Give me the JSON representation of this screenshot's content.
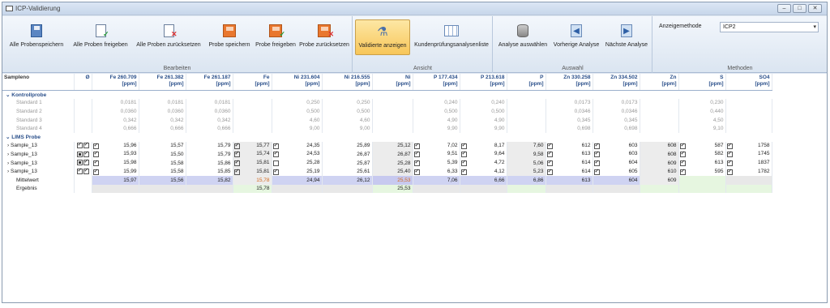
{
  "window": {
    "title": "ICP-Validierung"
  },
  "ribbon": {
    "bearbeiten": {
      "label": "Bearbeiten",
      "buttons": [
        "Alle Probenspeichern",
        "Alle Proben freigeben",
        "Alle Proben zurücksetzen",
        "Probe speichern",
        "Probe freigeben",
        "Probe zurücksetzen"
      ]
    },
    "ansicht": {
      "label": "Ansicht",
      "buttons": [
        "Validierte anzeigen",
        "Kundenprüfungsanalysenliste"
      ]
    },
    "auswahl": {
      "label": "Auswahl",
      "buttons": [
        "Analyse auswählen",
        "Vorherige Analyse",
        "Nächste Analyse"
      ]
    },
    "methoden": {
      "label": "Methoden",
      "anzeige_label": "Anzeigemethode",
      "anzeige_value": "ICP2"
    }
  },
  "table": {
    "headers": [
      [
        "Sampleno",
        ""
      ],
      [
        "Ø",
        ""
      ],
      [
        "Fe 260.709",
        "[ppm]"
      ],
      [
        "Fe 261.382",
        "[ppm]"
      ],
      [
        "Fe 261.187",
        "[ppm]"
      ],
      [
        "Fe",
        "[ppm]"
      ],
      [
        "Ni 231.604",
        "[ppm]"
      ],
      [
        "Ni 216.555",
        "[ppm]"
      ],
      [
        "Ni",
        "[ppm]"
      ],
      [
        "P 177.434",
        "[ppm]"
      ],
      [
        "P 213.618",
        "[ppm]"
      ],
      [
        "P",
        "[ppm]"
      ],
      [
        "Zn 330.258",
        "[ppm]"
      ],
      [
        "Zn 334.502",
        "[ppm]"
      ],
      [
        "Zn",
        "[ppm]"
      ],
      [
        "S",
        "[ppm]"
      ],
      [
        "SO4",
        "[ppm]"
      ]
    ],
    "kontroll_label": "Kontrollprobe",
    "standards": [
      {
        "name": "Standard 1",
        "v": [
          "",
          "0,0181",
          "0,0181",
          "0,0181",
          "",
          "0,250",
          "0,250",
          "",
          "0,240",
          "0,240",
          "",
          "0,0173",
          "0,0173",
          "",
          "0,230",
          ""
        ]
      },
      {
        "name": "Standard 2",
        "v": [
          "",
          "0,0360",
          "0,0360",
          "0,0360",
          "",
          "0,500",
          "0,500",
          "",
          "0,500",
          "0,500",
          "",
          "0,0346",
          "0,0346",
          "",
          "0,440",
          ""
        ]
      },
      {
        "name": "Standard 3",
        "v": [
          "",
          "0,342",
          "0,342",
          "0,342",
          "",
          "4,60",
          "4,60",
          "",
          "4,90",
          "4,90",
          "",
          "0,345",
          "0,345",
          "",
          "4,50",
          ""
        ]
      },
      {
        "name": "Standard 4",
        "v": [
          "",
          "0,666",
          "0,666",
          "0,666",
          "",
          "9,00",
          "9,00",
          "",
          "9,90",
          "9,90",
          "",
          "0,698",
          "0,698",
          "",
          "9,10",
          ""
        ]
      }
    ],
    "lims_label": "LIMS Probe",
    "samples": [
      {
        "name": "Sample_13",
        "v": [
          "",
          "15,96",
          "15,57",
          "15,79",
          "15,77",
          "24,35",
          "25,89",
          "25,12",
          "7,02",
          "8,17",
          "7,60",
          "612",
          "603",
          "608",
          "587",
          "1758"
        ]
      },
      {
        "name": "Sample_13",
        "v": [
          "",
          "15,93",
          "15,50",
          "15,79",
          "15,74",
          "24,53",
          "26,87",
          "26,87",
          "9,51",
          "9,64",
          "9,58",
          "613",
          "603",
          "608",
          "582",
          "1745"
        ]
      },
      {
        "name": "Sample_13",
        "v": [
          "",
          "15,98",
          "15,58",
          "15,86",
          "15,81",
          "25,28",
          "25,87",
          "25,28",
          "5,39",
          "4,72",
          "5,06",
          "614",
          "604",
          "609",
          "613",
          "1837"
        ]
      },
      {
        "name": "Sample_13",
        "v": [
          "",
          "15,99",
          "15,58",
          "15,85",
          "15,81",
          "25,19",
          "25,61",
          "25,40",
          "6,33",
          "4,12",
          "5,23",
          "614",
          "605",
          "610",
          "595",
          "1782"
        ]
      }
    ],
    "mittelwert": {
      "name": "Mittelwert",
      "v": [
        "",
        "15,97",
        "15,56",
        "15,82",
        "15,78",
        "24,94",
        "26,12",
        "25,53",
        "7,06",
        "6,66",
        "6,86",
        "613",
        "604",
        "609",
        "",
        ""
      ]
    },
    "ergebnis": {
      "name": "Ergebnis",
      "v": [
        "",
        "",
        "",
        "",
        "15,78",
        "",
        "",
        "25,53",
        "",
        "",
        "",
        "",
        "",
        "",
        "",
        ""
      ]
    }
  }
}
